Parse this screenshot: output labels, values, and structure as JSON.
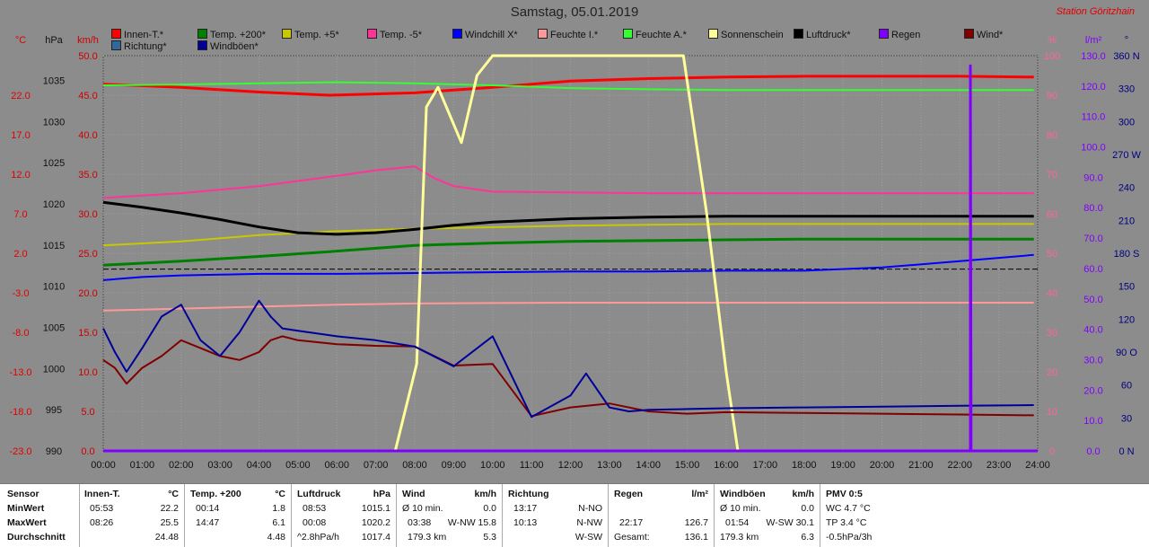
{
  "header": {
    "title": "Samstag, 05.01.2019",
    "station": "Station Göritzhain"
  },
  "legend": [
    {
      "label": "Innen-T.*",
      "color": "#ff0000"
    },
    {
      "label": "Temp. +200*",
      "color": "#008000"
    },
    {
      "label": "Temp. +5*",
      "color": "#c8c800"
    },
    {
      "label": "Temp. -5*",
      "color": "#ff3399"
    },
    {
      "label": "Windchill X*",
      "color": "#0000ff"
    },
    {
      "label": "Feuchte I.*",
      "color": "#ff9999"
    },
    {
      "label": "Feuchte A.*",
      "color": "#33ff33"
    },
    {
      "label": "Sonnenschein",
      "color": "#ffff99"
    },
    {
      "label": "Luftdruck*",
      "color": "#000000"
    },
    {
      "label": "Regen",
      "color": "#8000ff"
    },
    {
      "label": "Wind*",
      "color": "#800000"
    },
    {
      "label": "Richtung*",
      "color": "#336699"
    },
    {
      "label": "Windböen*",
      "color": "#000099"
    }
  ],
  "chart_data": {
    "type": "line",
    "title": "Samstag, 05.01.2019",
    "x_range": [
      0,
      24
    ],
    "x_ticks": [
      "00:00",
      "01:00",
      "02:00",
      "03:00",
      "04:00",
      "05:00",
      "06:00",
      "07:00",
      "08:00",
      "09:00",
      "10:00",
      "11:00",
      "12:00",
      "13:00",
      "14:00",
      "15:00",
      "16:00",
      "17:00",
      "18:00",
      "19:00",
      "20:00",
      "21:00",
      "22:00",
      "23:00",
      "24:00"
    ],
    "grid": true,
    "axes": {
      "temp": {
        "unit": "°C",
        "range": [
          -23,
          27
        ],
        "ticks": [
          "22.0",
          "17.0",
          "12.0",
          "7.0",
          "2.0",
          "-3.0",
          "-8.0",
          "-13.0",
          "-18.0",
          "-23.0"
        ],
        "color": "#e00000"
      },
      "press": {
        "unit": "hPa",
        "range": [
          990,
          1038
        ],
        "ticks": [
          "1035",
          "1030",
          "1025",
          "1020",
          "1015",
          "1010",
          "1005",
          "1000",
          "995",
          "990"
        ],
        "color": "#111111"
      },
      "wind": {
        "unit": "km/h",
        "range": [
          0,
          50
        ],
        "ticks": [
          "50.0",
          "45.0",
          "40.0",
          "35.0",
          "30.0",
          "25.0",
          "20.0",
          "15.0",
          "10.0",
          "5.0",
          "0.0"
        ],
        "color": "#cc0000"
      },
      "hum": {
        "unit": "%",
        "range": [
          0,
          100
        ],
        "ticks": [
          "100",
          "90",
          "80",
          "70",
          "60",
          "50",
          "40",
          "30",
          "20",
          "10",
          "0"
        ],
        "color": "#ff6699"
      },
      "rain": {
        "unit": "l/m²",
        "range": [
          0,
          130
        ],
        "ticks": [
          "130.0",
          "120.0",
          "110.0",
          "100.0",
          "90.0",
          "80.0",
          "70.0",
          "60.0",
          "50.0",
          "40.0",
          "30.0",
          "20.0",
          "10.0",
          "0.0"
        ],
        "color": "#8000ff"
      },
      "dir": {
        "unit": "°",
        "range": [
          0,
          360
        ],
        "ticks": [
          "360 N",
          "330",
          "300",
          "270 W",
          "240",
          "210",
          "180 S",
          "150",
          "120",
          "90 O",
          "60",
          "30",
          "0 N"
        ],
        "color": "#000080"
      }
    },
    "series": [
      {
        "name": "Innen-T.*",
        "axis": "temp",
        "color": "#ff0000",
        "width": 3,
        "x": [
          0,
          2,
          4,
          5.8,
          8,
          10,
          12,
          14,
          16,
          18,
          20,
          22,
          23.9
        ],
        "y": [
          23.4,
          23.0,
          22.4,
          22.0,
          22.3,
          23.0,
          23.8,
          24.1,
          24.3,
          24.4,
          24.4,
          24.4,
          24.3
        ]
      },
      {
        "name": "Temp. +200*",
        "axis": "temp",
        "color": "#008000",
        "width": 3,
        "x": [
          0,
          2,
          4,
          5.8,
          8,
          10,
          12,
          14,
          16,
          18,
          20,
          22,
          23.9
        ],
        "y": [
          0.5,
          1.0,
          1.6,
          2.2,
          3.0,
          3.3,
          3.5,
          3.6,
          3.7,
          3.8,
          3.8,
          3.8,
          3.8
        ]
      },
      {
        "name": "Temp. +5*",
        "axis": "temp",
        "color": "#c8c800",
        "width": 2,
        "x": [
          0,
          2,
          4,
          6,
          8,
          10,
          12,
          14,
          16,
          18,
          20,
          22,
          23.9
        ],
        "y": [
          3.0,
          3.5,
          4.3,
          4.8,
          5.1,
          5.3,
          5.5,
          5.6,
          5.7,
          5.7,
          5.7,
          5.7,
          5.7
        ]
      },
      {
        "name": "Temp. -5*",
        "axis": "temp",
        "color": "#ff3399",
        "width": 2,
        "x": [
          0,
          2,
          4,
          6,
          7,
          8,
          8.5,
          9,
          10,
          12,
          14,
          16,
          18,
          20,
          22,
          23.9
        ],
        "y": [
          9.0,
          9.6,
          10.5,
          11.8,
          12.5,
          13.0,
          11.5,
          10.5,
          9.8,
          9.7,
          9.6,
          9.6,
          9.6,
          9.6,
          9.6,
          9.6
        ]
      },
      {
        "name": "Windchill X*",
        "axis": "temp",
        "color": "#0000ff",
        "width": 2,
        "x": [
          0,
          1,
          2,
          3,
          4,
          5,
          6,
          8,
          10,
          12,
          14,
          16,
          18,
          20,
          22,
          23.9
        ],
        "y": [
          -1.4,
          -1.0,
          -0.8,
          -0.7,
          -0.6,
          -0.6,
          -0.6,
          -0.5,
          -0.4,
          -0.3,
          -0.3,
          -0.2,
          -0.2,
          0.2,
          1.0,
          1.8
        ]
      },
      {
        "name": "Feuchte I.*",
        "axis": "hum",
        "color": "#ff9999",
        "width": 2,
        "x": [
          0,
          2,
          4,
          6,
          8,
          10,
          12,
          14,
          16,
          18,
          20,
          22,
          23.9
        ],
        "y": [
          35.5,
          36.0,
          36.5,
          37.0,
          37.3,
          37.4,
          37.5,
          37.5,
          37.5,
          37.5,
          37.5,
          37.5,
          37.5
        ]
      },
      {
        "name": "Feuchte A.*",
        "axis": "hum",
        "color": "#33ff33",
        "width": 2,
        "x": [
          0,
          2,
          4,
          6,
          8,
          10,
          12,
          14,
          16,
          18,
          20,
          22,
          23.9
        ],
        "y": [
          92.5,
          92.7,
          93.0,
          93.3,
          93.0,
          92.5,
          91.8,
          91.5,
          91.3,
          91.3,
          91.3,
          91.3,
          91.3
        ]
      },
      {
        "name": "Luftdruck*",
        "axis": "press",
        "color": "#000000",
        "width": 3,
        "x": [
          0,
          1,
          2,
          3,
          4,
          5,
          6,
          7,
          8,
          9,
          10,
          12,
          14,
          16,
          18,
          20,
          22,
          23.9
        ],
        "y": [
          1020.2,
          1019.6,
          1018.9,
          1018.1,
          1017.2,
          1016.5,
          1016.3,
          1016.5,
          1016.9,
          1017.4,
          1017.8,
          1018.2,
          1018.4,
          1018.5,
          1018.5,
          1018.5,
          1018.5,
          1018.5
        ]
      },
      {
        "name": "Sonnenschein",
        "axis": "hum",
        "color": "#ffff99",
        "width": 3,
        "x": [
          0,
          7.5,
          8.05,
          8.3,
          8.6,
          9.2,
          9.6,
          10.0,
          10.3,
          12.0,
          14.0,
          14.9,
          15.5,
          16.0,
          16.3,
          24.0
        ],
        "y": [
          0,
          0,
          22,
          87,
          92,
          78,
          95,
          100,
          100,
          100,
          100,
          100,
          60,
          20,
          0,
          0
        ]
      },
      {
        "name": "Wind*",
        "axis": "wind",
        "color": "#800000",
        "width": 2,
        "x": [
          0,
          0.3,
          0.6,
          1,
          1.5,
          2,
          2.5,
          3,
          3.5,
          4,
          4.3,
          4.6,
          5,
          6,
          7,
          8,
          9,
          10,
          11,
          12,
          13,
          14,
          15,
          16,
          18,
          20,
          22,
          23.9
        ],
        "y": [
          11.5,
          10.5,
          8.5,
          10.5,
          12.0,
          14.0,
          13.0,
          12.0,
          11.5,
          12.5,
          14.0,
          14.5,
          14.0,
          13.5,
          13.3,
          13.2,
          10.8,
          11.0,
          4.4,
          5.5,
          6.0,
          5.0,
          4.7,
          4.9,
          4.8,
          4.7,
          4.6,
          4.5
        ]
      },
      {
        "name": "Windböen*",
        "axis": "wind",
        "color": "#000099",
        "width": 2,
        "x": [
          0,
          0.3,
          0.6,
          1,
          1.5,
          2,
          2.5,
          3,
          3.5,
          4,
          4.3,
          4.6,
          5,
          6,
          7,
          8,
          9,
          10,
          11,
          12,
          12.4,
          13,
          13.5,
          14,
          15,
          16,
          18,
          20,
          22,
          23.9
        ],
        "y": [
          15.5,
          12.5,
          10.0,
          13.0,
          17.0,
          18.5,
          14.0,
          12.0,
          15.0,
          19.0,
          17.0,
          15.5,
          15.2,
          14.5,
          14.0,
          13.2,
          10.7,
          14.5,
          4.3,
          7.0,
          9.8,
          5.5,
          5.0,
          5.2,
          5.3,
          5.4,
          5.5,
          5.6,
          5.7,
          5.8
        ]
      },
      {
        "name": "Regen",
        "axis": "rain",
        "color": "#8000ff",
        "width": 3,
        "x": [
          0,
          22.27,
          22.27,
          22.29,
          24.0
        ],
        "y": [
          0,
          0,
          126.7,
          0,
          0
        ]
      }
    ]
  },
  "panel": {
    "sensor": {
      "head": "Sensor",
      "rows": [
        "MinWert",
        "MaxWert",
        "Durchschnitt"
      ]
    },
    "innen": {
      "head": "Innen-T.",
      "unit": "°C",
      "min_time": "05:53",
      "min_val": "22.2",
      "max_time": "08:26",
      "max_val": "25.5",
      "avg": "24.48"
    },
    "temp200": {
      "head": "Temp. +200",
      "unit": "°C",
      "min_time": "00:14",
      "min_val": "1.8",
      "max_time": "14:47",
      "max_val": "6.1",
      "avg": "4.48"
    },
    "luftdruck": {
      "head": "Luftdruck",
      "unit": "hPa",
      "min_time": "08:53",
      "min_val": "1015.1",
      "max_time": "00:08",
      "max_val": "1020.2",
      "trend": "^2.8hPa/h",
      "avg": "1017.4"
    },
    "wind": {
      "head": "Wind",
      "unit": "km/h",
      "r1a": "Ø 10 min.",
      "r1b": "0.0",
      "r2a": "03:38",
      "r2b": "W-NW 15.8",
      "r3a": "179.3 km",
      "r3b": "5.3"
    },
    "richtung": {
      "head": "Richtung",
      "r1a": "13:17",
      "r1b": "N-NO",
      "r2a": "10:13",
      "r2b": "N-NW",
      "r3b": "W-SW"
    },
    "regen": {
      "head": "Regen",
      "unit": "l/m²",
      "r2a": "22:17",
      "r2b": "126.7",
      "r3a": "Gesamt:",
      "r3b": "136.1"
    },
    "boeen": {
      "head": "Windböen",
      "unit": "km/h",
      "r1a": "Ø 10 min.",
      "r1b": "0.0",
      "r2a": "01:54",
      "r2b": "W-SW 30.1",
      "r3a": "179.3 km",
      "r3b": "6.3"
    },
    "pmv": {
      "head": "PMV 0:5",
      "r1": "WC 4.7 °C",
      "r2": "TP 3.4 °C",
      "r3": "-0.5hPa/3h"
    }
  }
}
